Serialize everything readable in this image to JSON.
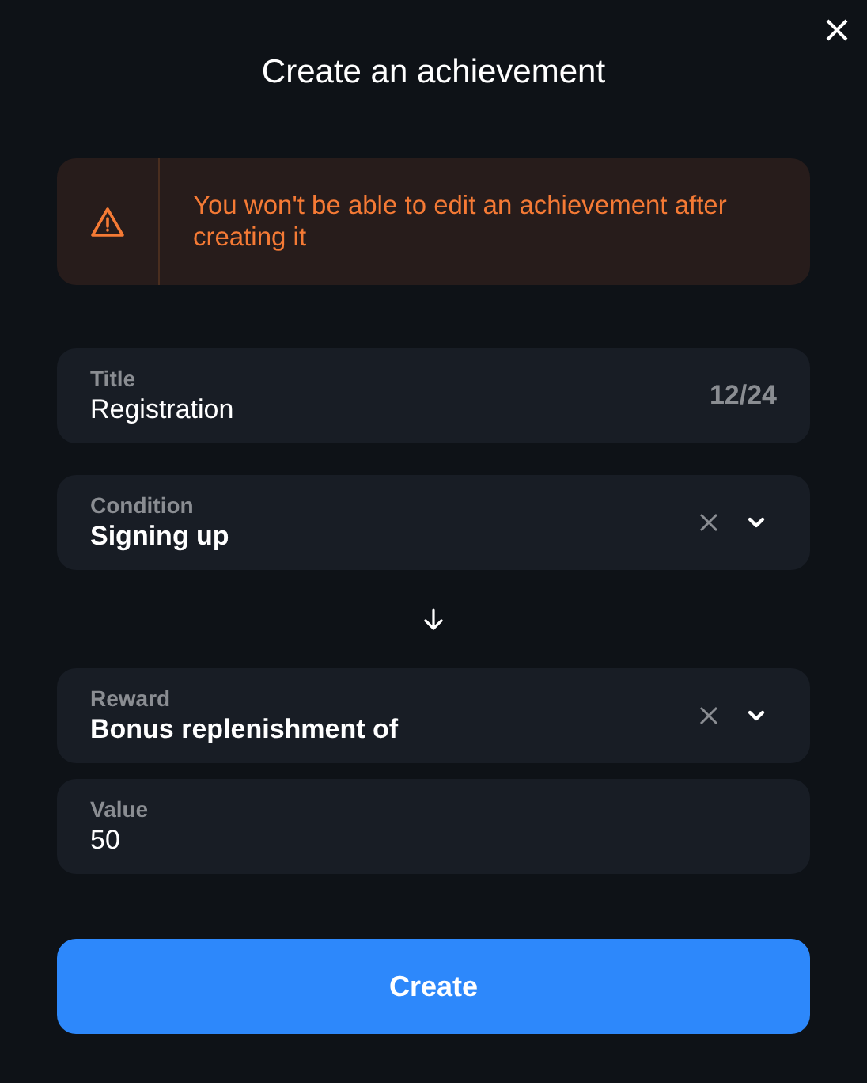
{
  "dialog": {
    "title": "Create an achievement"
  },
  "warning": {
    "text": "You won't be able to edit an achievement after creating it"
  },
  "fields": [
    {
      "kind": "text",
      "label": "Title",
      "value": "Registration",
      "counter": "12/24"
    },
    {
      "kind": "select",
      "label": "Condition",
      "value": "Signing up"
    },
    {
      "kind": "arrow"
    },
    {
      "kind": "select",
      "label": "Reward",
      "value": "Bonus replenishment of"
    },
    {
      "kind": "text",
      "label": "Value",
      "value": "50"
    }
  ],
  "buttons": {
    "create": "Create"
  }
}
